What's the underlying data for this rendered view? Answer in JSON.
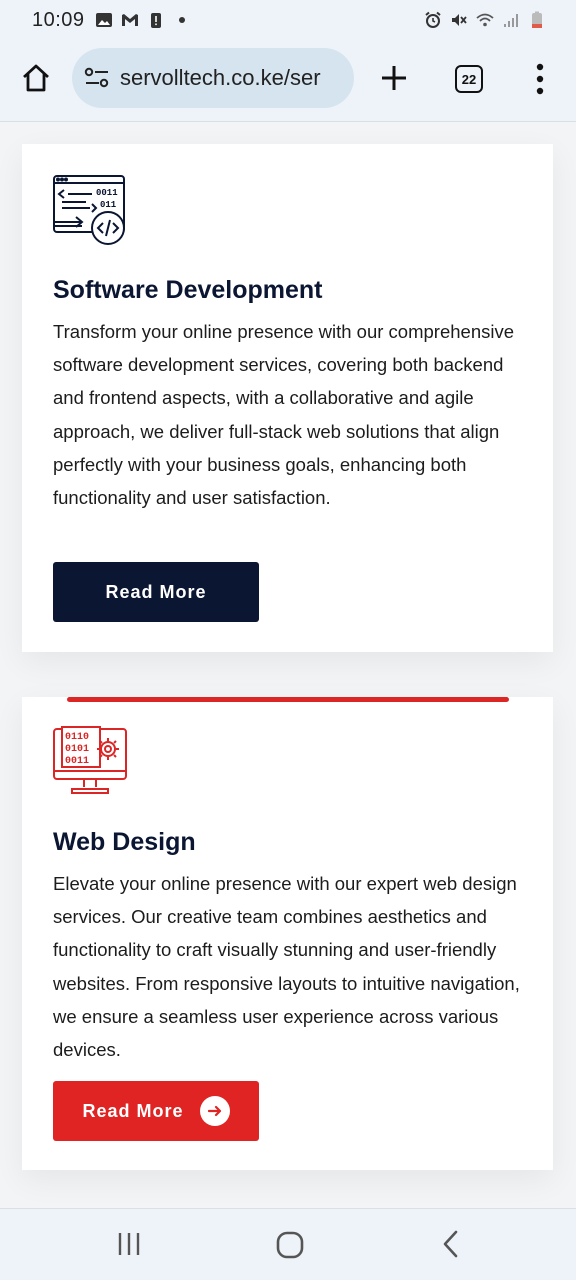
{
  "status_bar": {
    "time": "10:09",
    "left_icons": [
      "image-icon",
      "gmail-icon",
      "battery-alert-icon",
      "dot-icon"
    ],
    "right_icons": [
      "alarm-icon",
      "mute-icon",
      "wifi-icon",
      "signal-icon",
      "battery-icon"
    ]
  },
  "browser": {
    "url": "servolltech.co.ke/ser",
    "tab_count": "22"
  },
  "services": [
    {
      "icon": "code-icon",
      "title": "Software Development",
      "description": "Transform your online presence with our comprehensive software development services, covering both backend and frontend aspects, with a collaborative and agile approach, we deliver full-stack web solutions that align perfectly with your business goals, enhancing both functionality and user satisfaction.",
      "button_label": "Read More"
    },
    {
      "icon": "web-design-icon",
      "title": "Web Design",
      "description": "Elevate your online presence with our expert web design services. Our creative team combines aesthetics and functionality to craft visually stunning and user-friendly websites. From responsive layouts to intuitive navigation, we ensure a seamless user experience across various devices.",
      "button_label": "Read More"
    }
  ],
  "colors": {
    "navy": "#0b1633",
    "red": "#e02424",
    "browser_bg": "#eef3f9",
    "url_pill": "#d6e4ef"
  }
}
